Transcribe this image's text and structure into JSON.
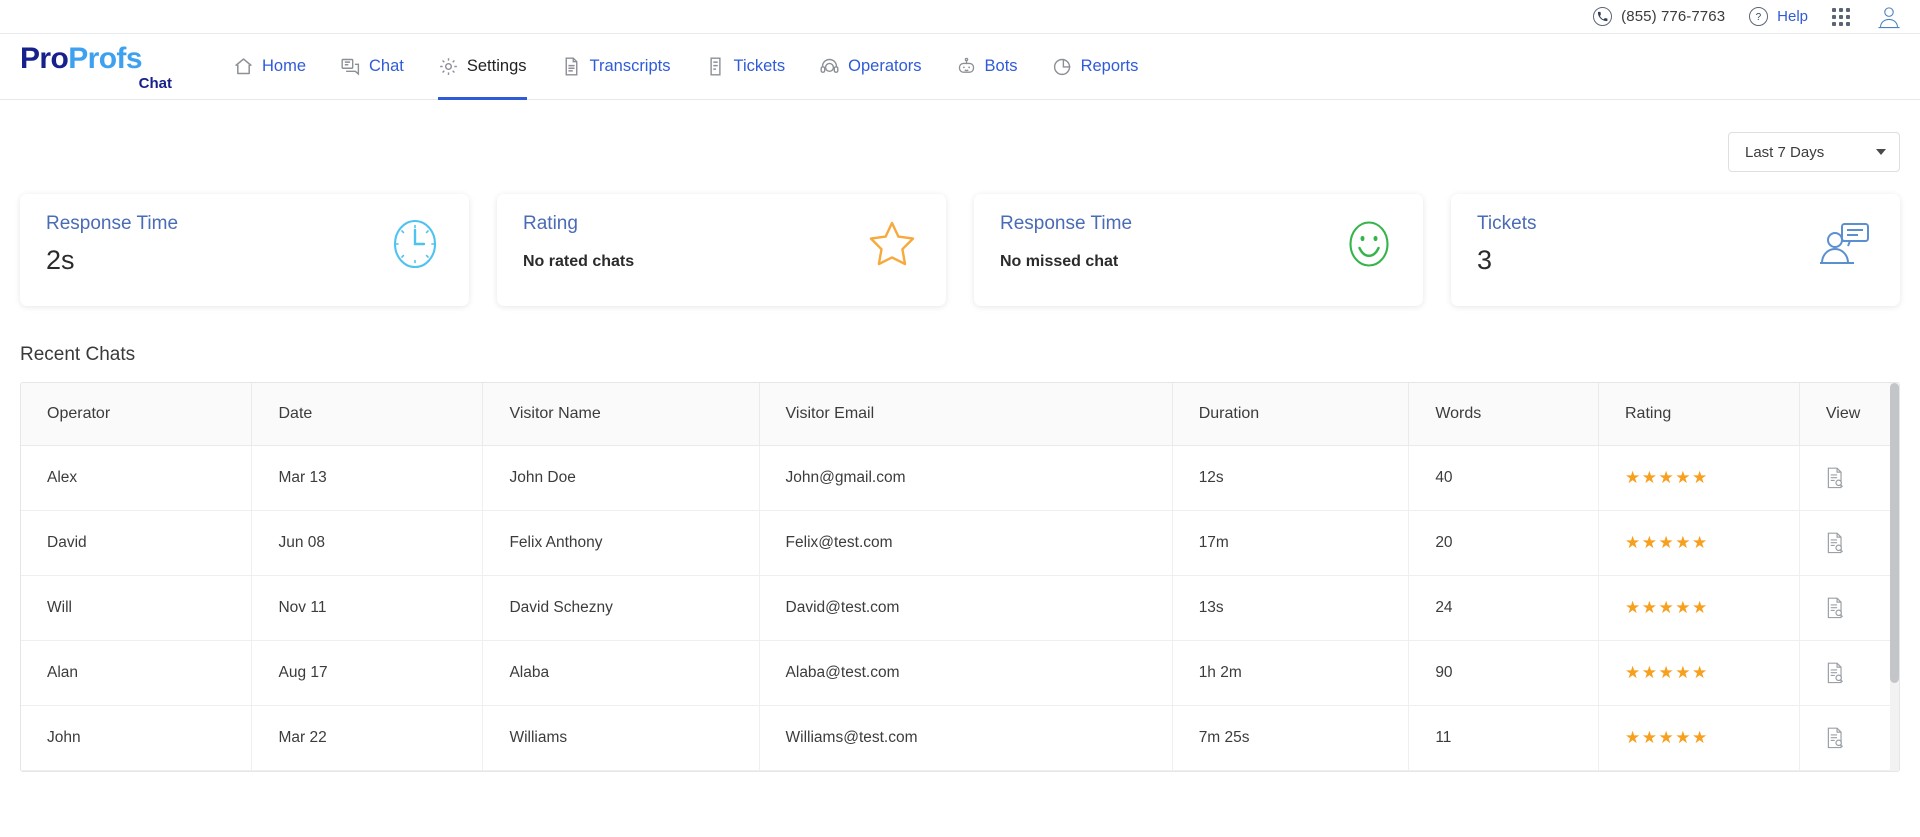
{
  "utility": {
    "phone_icon": "phone-icon",
    "phone": "(855) 776-7763",
    "help_icon": "question-mark-icon",
    "help": "Help",
    "apps_icon": "apps-grid-icon",
    "account_icon": "user-avatar-icon"
  },
  "brand": {
    "name_part1": "Pro",
    "name_part2": "Profs",
    "sub": "Chat",
    "color_dark": "#17218c",
    "color_light": "#3ea1f0"
  },
  "nav": {
    "active": "Settings",
    "accent": "#2f5bd8",
    "items": [
      {
        "label": "Home",
        "icon": "home-icon"
      },
      {
        "label": "Chat",
        "icon": "chat-bubbles-icon"
      },
      {
        "label": "Settings",
        "icon": "gear-icon"
      },
      {
        "label": "Transcripts",
        "icon": "document-icon"
      },
      {
        "label": "Tickets",
        "icon": "ticket-icon"
      },
      {
        "label": "Operators",
        "icon": "headset-icon"
      },
      {
        "label": "Bots",
        "icon": "robot-icon"
      },
      {
        "label": "Reports",
        "icon": "pie-chart-icon"
      }
    ]
  },
  "filter": {
    "selected": "Last 7 Days",
    "caret_icon": "chevron-down-icon"
  },
  "cards": [
    {
      "title": "Response Time",
      "value": "2s",
      "value_size": "large",
      "icon": "clock-icon",
      "icon_color": "#4ec3f0"
    },
    {
      "title": "Rating",
      "value": "No rated chats",
      "value_size": "small",
      "icon": "star-icon",
      "icon_color": "#f7a93b"
    },
    {
      "title": "Response Time",
      "value": "No missed chat",
      "value_size": "small",
      "icon": "smiley-icon",
      "icon_color": "#35b44b"
    },
    {
      "title": "Tickets",
      "value": "3",
      "value_size": "large",
      "icon": "ticket-agent-icon",
      "icon_color": "#5a8fd0"
    }
  ],
  "table": {
    "section_title": "Recent Chats",
    "columns": [
      "Operator",
      "Date",
      "Visitor Name",
      "Visitor Email",
      "Duration",
      "Words",
      "Rating",
      "View"
    ],
    "rows": [
      {
        "operator": "Alex",
        "date": "Mar 13",
        "visitor_name": "John Doe",
        "visitor_email": "John@gmail.com",
        "duration": "12s",
        "words": "40",
        "rating": 5,
        "view_icon": "document-search-icon"
      },
      {
        "operator": "David",
        "date": "Jun 08",
        "visitor_name": " Felix Anthony",
        "visitor_email": "Felix@test.com",
        "duration": "17m",
        "words": "20",
        "rating": 5,
        "view_icon": "document-search-icon"
      },
      {
        "operator": "Will",
        "date": "Nov 11",
        "visitor_name": "David Schezny",
        "visitor_email": "David@test.com",
        "duration": "13s",
        "words": "24",
        "rating": 5,
        "view_icon": "document-search-icon"
      },
      {
        "operator": "Alan",
        "date": "Aug 17",
        "visitor_name": "Alaba",
        "visitor_email": "Alaba@test.com",
        "duration": "1h 2m",
        "words": "90",
        "rating": 5,
        "view_icon": "document-search-icon"
      },
      {
        "operator": "John",
        "date": "Mar 22",
        "visitor_name": "Williams",
        "visitor_email": "Williams@test.com",
        "duration": "7m 25s",
        "words": "11",
        "rating": 5,
        "view_icon": "document-search-icon"
      }
    ],
    "star_glyph": "★",
    "star_color": "#f7a01f"
  }
}
